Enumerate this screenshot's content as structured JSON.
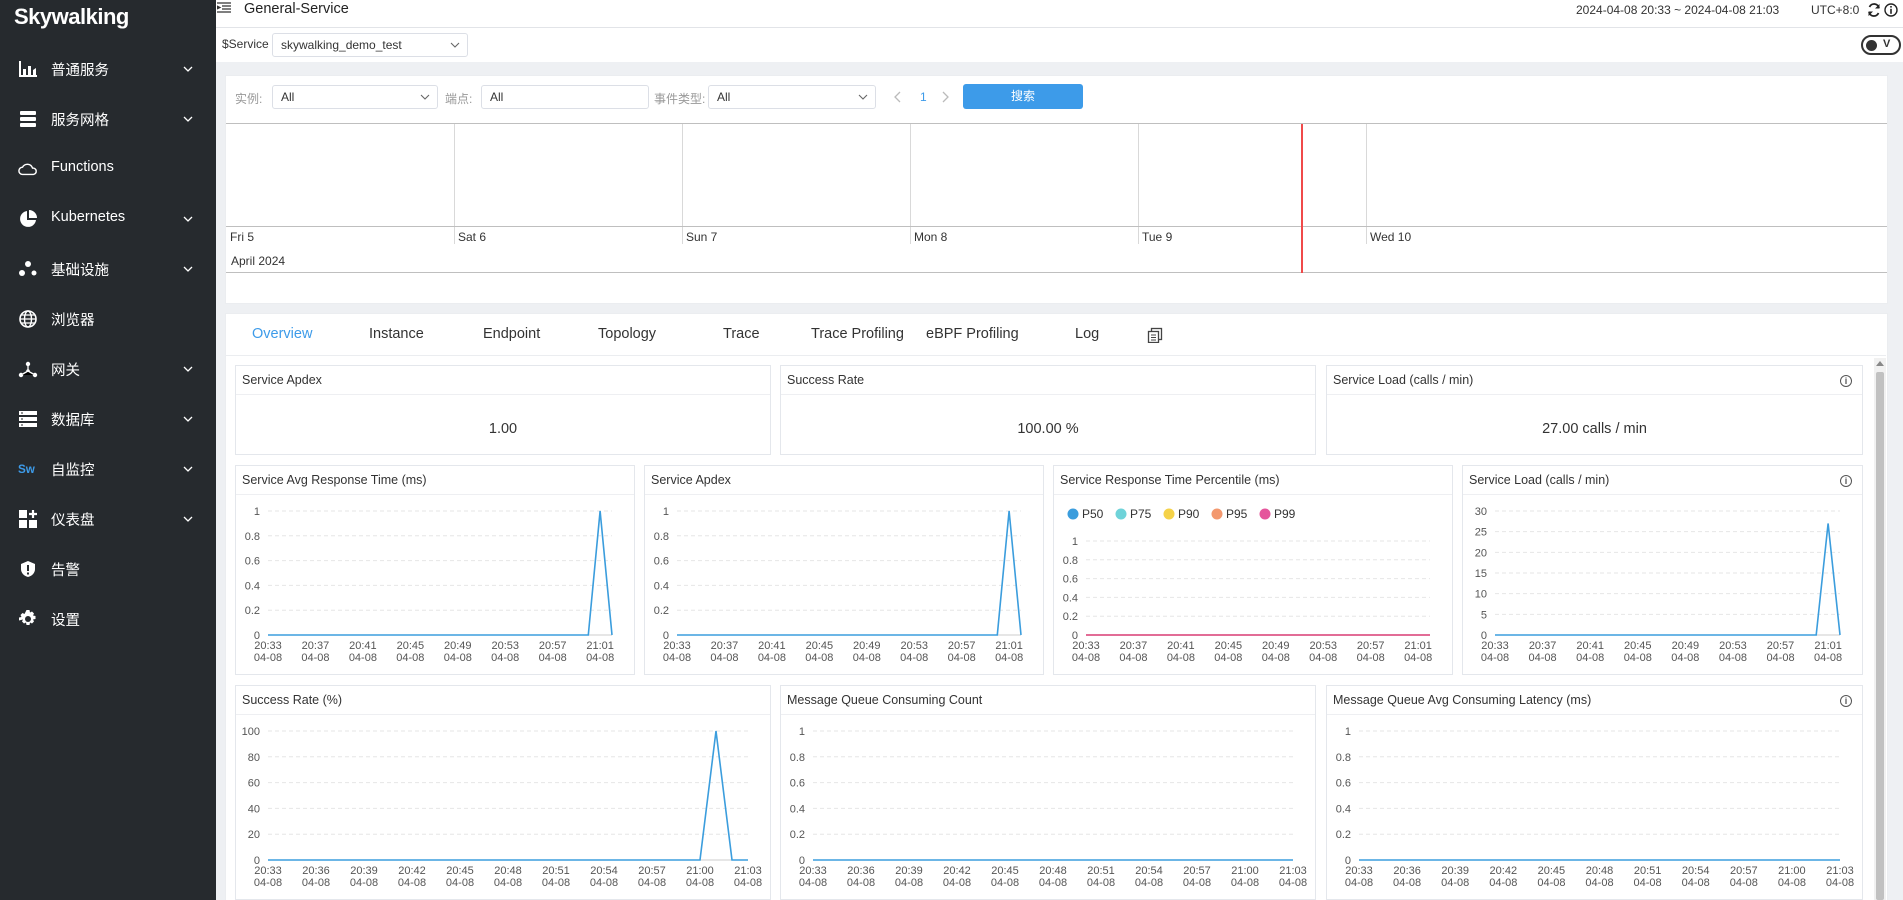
{
  "app": {
    "logo": "Skywalking"
  },
  "sidebar": {
    "items": [
      {
        "label": "普通服务",
        "icon": "bar-chart-icon",
        "expandable": true
      },
      {
        "label": "服务网格",
        "icon": "layers-icon",
        "expandable": true
      },
      {
        "label": "Functions",
        "icon": "cloud-icon",
        "expandable": false
      },
      {
        "label": "Kubernetes",
        "icon": "pie-chart-icon",
        "expandable": true
      },
      {
        "label": "基础设施",
        "icon": "dots-icon",
        "expandable": true
      },
      {
        "label": "浏览器",
        "icon": "globe-icon",
        "expandable": false
      },
      {
        "label": "网关",
        "icon": "gateway-icon",
        "expandable": true
      },
      {
        "label": "数据库",
        "icon": "database-icon",
        "expandable": true
      },
      {
        "label": "自监控",
        "icon": "sw-icon",
        "expandable": true
      },
      {
        "label": "仪表盘",
        "icon": "dashboard-icon",
        "expandable": true
      },
      {
        "label": "告警",
        "icon": "alert-icon",
        "expandable": false
      },
      {
        "label": "设置",
        "icon": "gear-icon",
        "expandable": false
      }
    ]
  },
  "header": {
    "title": "General-Service",
    "time_range": "2024-04-08 20:33 ~ 2024-04-08 21:03",
    "timezone": "UTC+8:0"
  },
  "filter": {
    "service_label": "$Service",
    "service_value": "skywalking_demo_test",
    "toggle_label": "V"
  },
  "events": {
    "instance_label": "实例:",
    "instance_value": "All",
    "endpoint_label": "端点:",
    "endpoint_value": "All",
    "type_label": "事件类型:",
    "type_value": "All",
    "page": "1",
    "search_label": "搜索",
    "days": [
      "Fri 5",
      "Sat 6",
      "Sun 7",
      "Mon 8",
      "Tue 9",
      "Wed 10"
    ],
    "month": "April 2024"
  },
  "tabs": [
    "Overview",
    "Instance",
    "Endpoint",
    "Topology",
    "Trace",
    "Trace Profiling",
    "eBPF Profiling",
    "Log"
  ],
  "cards": {
    "apdex": {
      "title": "Service Apdex",
      "value": "1.00"
    },
    "success": {
      "title": "Success Rate",
      "value": "100.00 %"
    },
    "load": {
      "title": "Service Load (calls / min)",
      "value": "27.00 calls / min"
    }
  },
  "chart_data": [
    {
      "type": "line",
      "title": "Service Avg Response Time (ms)",
      "x": [
        "20:33",
        "20:34",
        "20:35",
        "20:36",
        "20:37",
        "20:38",
        "20:39",
        "20:40",
        "20:41",
        "20:42",
        "20:43",
        "20:44",
        "20:45",
        "20:46",
        "20:47",
        "20:48",
        "20:49",
        "20:50",
        "20:51",
        "20:52",
        "20:53",
        "20:54",
        "20:55",
        "20:56",
        "20:57",
        "20:58",
        "20:59",
        "21:00",
        "21:01",
        "21:02"
      ],
      "tick_labels": [
        "20:33",
        "20:37",
        "20:41",
        "20:45",
        "20:49",
        "20:53",
        "20:57",
        "21:01"
      ],
      "tick_date": "04-08",
      "yticks": [
        "0",
        "0.2",
        "0.4",
        "0.6",
        "0.8",
        "1"
      ],
      "ylim": [
        0,
        1
      ],
      "series": [
        {
          "values": [
            0,
            0,
            0,
            0,
            0,
            0,
            0,
            0,
            0,
            0,
            0,
            0,
            0,
            0,
            0,
            0,
            0,
            0,
            0,
            0,
            0,
            0,
            0,
            0,
            0,
            0,
            0,
            0,
            1,
            0
          ],
          "color": "#3b9ddd"
        }
      ]
    },
    {
      "type": "line",
      "title": "Service Apdex",
      "x": [
        "20:33",
        "20:34",
        "20:35",
        "20:36",
        "20:37",
        "20:38",
        "20:39",
        "20:40",
        "20:41",
        "20:42",
        "20:43",
        "20:44",
        "20:45",
        "20:46",
        "20:47",
        "20:48",
        "20:49",
        "20:50",
        "20:51",
        "20:52",
        "20:53",
        "20:54",
        "20:55",
        "20:56",
        "20:57",
        "20:58",
        "20:59",
        "21:00",
        "21:01",
        "21:02"
      ],
      "tick_labels": [
        "20:33",
        "20:37",
        "20:41",
        "20:45",
        "20:49",
        "20:53",
        "20:57",
        "21:01"
      ],
      "tick_date": "04-08",
      "yticks": [
        "0",
        "0.2",
        "0.4",
        "0.6",
        "0.8",
        "1"
      ],
      "ylim": [
        0,
        1
      ],
      "series": [
        {
          "values": [
            0,
            0,
            0,
            0,
            0,
            0,
            0,
            0,
            0,
            0,
            0,
            0,
            0,
            0,
            0,
            0,
            0,
            0,
            0,
            0,
            0,
            0,
            0,
            0,
            0,
            0,
            0,
            0,
            1,
            0
          ],
          "color": "#3b9ddd"
        }
      ]
    },
    {
      "type": "line",
      "title": "Service Response Time Percentile (ms)",
      "x": [
        "20:33",
        "20:34",
        "20:35",
        "20:36",
        "20:37",
        "20:38",
        "20:39",
        "20:40",
        "20:41",
        "20:42",
        "20:43",
        "20:44",
        "20:45",
        "20:46",
        "20:47",
        "20:48",
        "20:49",
        "20:50",
        "20:51",
        "20:52",
        "20:53",
        "20:54",
        "20:55",
        "20:56",
        "20:57",
        "20:58",
        "20:59",
        "21:00",
        "21:01",
        "21:02"
      ],
      "tick_labels": [
        "20:33",
        "20:37",
        "20:41",
        "20:45",
        "20:49",
        "20:53",
        "20:57",
        "21:01"
      ],
      "tick_date": "04-08",
      "yticks": [
        "0",
        "0.2",
        "0.4",
        "0.6",
        "0.8",
        "1"
      ],
      "ylim": [
        0,
        1
      ],
      "legend": "top-left",
      "series": [
        {
          "name": "P50",
          "color": "#3b9ddd",
          "values": [
            0,
            0,
            0,
            0,
            0,
            0,
            0,
            0,
            0,
            0,
            0,
            0,
            0,
            0,
            0,
            0,
            0,
            0,
            0,
            0,
            0,
            0,
            0,
            0,
            0,
            0,
            0,
            0,
            0,
            0
          ]
        },
        {
          "name": "P75",
          "color": "#6fd3d9",
          "values": [
            0,
            0,
            0,
            0,
            0,
            0,
            0,
            0,
            0,
            0,
            0,
            0,
            0,
            0,
            0,
            0,
            0,
            0,
            0,
            0,
            0,
            0,
            0,
            0,
            0,
            0,
            0,
            0,
            0,
            0
          ]
        },
        {
          "name": "P90",
          "color": "#f5d248",
          "values": [
            0,
            0,
            0,
            0,
            0,
            0,
            0,
            0,
            0,
            0,
            0,
            0,
            0,
            0,
            0,
            0,
            0,
            0,
            0,
            0,
            0,
            0,
            0,
            0,
            0,
            0,
            0,
            0,
            0,
            0
          ]
        },
        {
          "name": "P95",
          "color": "#f3986e",
          "values": [
            0,
            0,
            0,
            0,
            0,
            0,
            0,
            0,
            0,
            0,
            0,
            0,
            0,
            0,
            0,
            0,
            0,
            0,
            0,
            0,
            0,
            0,
            0,
            0,
            0,
            0,
            0,
            0,
            0,
            0
          ]
        },
        {
          "name": "P99",
          "color": "#e5559c",
          "values": [
            0,
            0,
            0,
            0,
            0,
            0,
            0,
            0,
            0,
            0,
            0,
            0,
            0,
            0,
            0,
            0,
            0,
            0,
            0,
            0,
            0,
            0,
            0,
            0,
            0,
            0,
            0,
            0,
            0,
            0
          ]
        }
      ]
    },
    {
      "type": "line",
      "title": "Service Load (calls / min)",
      "x": [
        "20:33",
        "20:34",
        "20:35",
        "20:36",
        "20:37",
        "20:38",
        "20:39",
        "20:40",
        "20:41",
        "20:42",
        "20:43",
        "20:44",
        "20:45",
        "20:46",
        "20:47",
        "20:48",
        "20:49",
        "20:50",
        "20:51",
        "20:52",
        "20:53",
        "20:54",
        "20:55",
        "20:56",
        "20:57",
        "20:58",
        "20:59",
        "21:00",
        "21:01",
        "21:02"
      ],
      "tick_labels": [
        "20:33",
        "20:37",
        "20:41",
        "20:45",
        "20:49",
        "20:53",
        "20:57",
        "21:01"
      ],
      "tick_date": "04-08",
      "yticks": [
        "0",
        "5",
        "10",
        "15",
        "20",
        "25",
        "30"
      ],
      "ylim": [
        0,
        30
      ],
      "series": [
        {
          "values": [
            0,
            0,
            0,
            0,
            0,
            0,
            0,
            0,
            0,
            0,
            0,
            0,
            0,
            0,
            0,
            0,
            0,
            0,
            0,
            0,
            0,
            0,
            0,
            0,
            0,
            0,
            0,
            0,
            27,
            0
          ],
          "color": "#3b9ddd"
        }
      ]
    },
    {
      "type": "line",
      "title": "Success Rate (%)",
      "x": [
        "20:33",
        "20:34",
        "20:35",
        "20:36",
        "20:37",
        "20:38",
        "20:39",
        "20:40",
        "20:41",
        "20:42",
        "20:43",
        "20:44",
        "20:45",
        "20:46",
        "20:47",
        "20:48",
        "20:49",
        "20:50",
        "20:51",
        "20:52",
        "20:53",
        "20:54",
        "20:55",
        "20:56",
        "20:57",
        "20:58",
        "20:59",
        "21:00",
        "21:01",
        "21:02",
        "21:03"
      ],
      "tick_labels": [
        "20:33",
        "20:36",
        "20:39",
        "20:42",
        "20:45",
        "20:48",
        "20:51",
        "20:54",
        "20:57",
        "21:00",
        "21:03"
      ],
      "tick_date": "04-08",
      "yticks": [
        "0",
        "20",
        "40",
        "60",
        "80",
        "100"
      ],
      "ylim": [
        0,
        100
      ],
      "series": [
        {
          "values": [
            0,
            0,
            0,
            0,
            0,
            0,
            0,
            0,
            0,
            0,
            0,
            0,
            0,
            0,
            0,
            0,
            0,
            0,
            0,
            0,
            0,
            0,
            0,
            0,
            0,
            0,
            0,
            0,
            100,
            0,
            0
          ],
          "color": "#3b9ddd"
        }
      ]
    },
    {
      "type": "line",
      "title": "Message Queue Consuming Count",
      "x": [
        "20:33",
        "20:34",
        "20:35",
        "20:36",
        "20:37",
        "20:38",
        "20:39",
        "20:40",
        "20:41",
        "20:42",
        "20:43",
        "20:44",
        "20:45",
        "20:46",
        "20:47",
        "20:48",
        "20:49",
        "20:50",
        "20:51",
        "20:52",
        "20:53",
        "20:54",
        "20:55",
        "20:56",
        "20:57",
        "20:58",
        "20:59",
        "21:00",
        "21:01",
        "21:02",
        "21:03"
      ],
      "tick_labels": [
        "20:33",
        "20:36",
        "20:39",
        "20:42",
        "20:45",
        "20:48",
        "20:51",
        "20:54",
        "20:57",
        "21:00",
        "21:03"
      ],
      "tick_date": "04-08",
      "yticks": [
        "0",
        "0.2",
        "0.4",
        "0.6",
        "0.8",
        "1"
      ],
      "ylim": [
        0,
        1
      ],
      "series": [
        {
          "values": [
            0,
            0,
            0,
            0,
            0,
            0,
            0,
            0,
            0,
            0,
            0,
            0,
            0,
            0,
            0,
            0,
            0,
            0,
            0,
            0,
            0,
            0,
            0,
            0,
            0,
            0,
            0,
            0,
            0,
            0,
            0
          ],
          "color": "#3b9ddd"
        }
      ]
    },
    {
      "type": "line",
      "title": "Message Queue Avg Consuming Latency (ms)",
      "x": [
        "20:33",
        "20:34",
        "20:35",
        "20:36",
        "20:37",
        "20:38",
        "20:39",
        "20:40",
        "20:41",
        "20:42",
        "20:43",
        "20:44",
        "20:45",
        "20:46",
        "20:47",
        "20:48",
        "20:49",
        "20:50",
        "20:51",
        "20:52",
        "20:53",
        "20:54",
        "20:55",
        "20:56",
        "20:57",
        "20:58",
        "20:59",
        "21:00",
        "21:01",
        "21:02",
        "21:03"
      ],
      "tick_labels": [
        "20:33",
        "20:36",
        "20:39",
        "20:42",
        "20:45",
        "20:48",
        "20:51",
        "20:54",
        "20:57",
        "21:00",
        "21:03"
      ],
      "tick_date": "04-08",
      "yticks": [
        "0",
        "0.2",
        "0.4",
        "0.6",
        "0.8",
        "1"
      ],
      "ylim": [
        0,
        1
      ],
      "series": [
        {
          "values": [
            0,
            0,
            0,
            0,
            0,
            0,
            0,
            0,
            0,
            0,
            0,
            0,
            0,
            0,
            0,
            0,
            0,
            0,
            0,
            0,
            0,
            0,
            0,
            0,
            0,
            0,
            0,
            0,
            0,
            0,
            0
          ],
          "color": "#3b9ddd"
        }
      ]
    }
  ]
}
